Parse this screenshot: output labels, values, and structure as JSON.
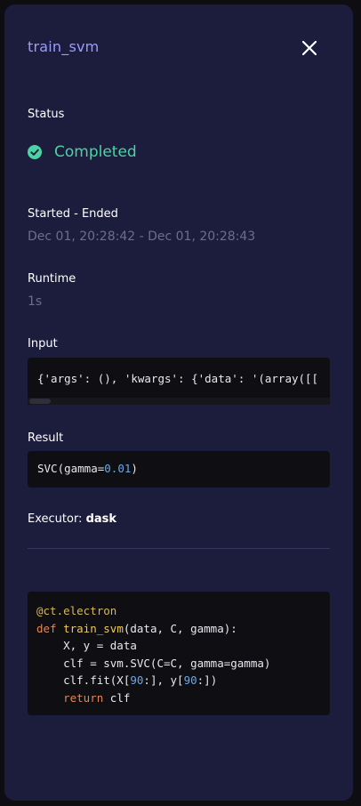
{
  "header": {
    "title": "train_svm",
    "close_icon": "close-icon"
  },
  "status": {
    "label": "Status",
    "value": "Completed",
    "icon": "check-circle-icon",
    "color": "#4cd3a3"
  },
  "timing": {
    "label": "Started - Ended",
    "value": "Dec 01, 20:28:42 - Dec 01, 20:28:43"
  },
  "runtime": {
    "label": "Runtime",
    "value": "1s"
  },
  "input": {
    "label": "Input",
    "value": "{'args': (), 'kwargs': {'data': '(array([["
  },
  "result": {
    "label": "Result",
    "prefix": "SVC(gamma=",
    "number": "0.01",
    "suffix": ")"
  },
  "executor": {
    "label": "Executor:",
    "value": "dask"
  },
  "source": {
    "line1_decorator": "@ct.electron",
    "line2_kw": "def",
    "line2_fn": "train_svm",
    "line2_rest": "(data, C, gamma):",
    "line3": "    X, y = data",
    "line4": "    clf = svm.SVC(C=C, gamma=gamma)",
    "line5_pre": "    clf.fit(X[",
    "line5_n1": "90",
    "line5_mid": ":], y[",
    "line5_n2": "90",
    "line5_post": ":])",
    "line6_indent": "    ",
    "line6_kw": "return",
    "line6_rest": " clf"
  },
  "colors": {
    "background": "#1c1c3d",
    "title": "#9a9cff",
    "muted": "#6c6e8c",
    "code_bg": "#0e0e13"
  }
}
